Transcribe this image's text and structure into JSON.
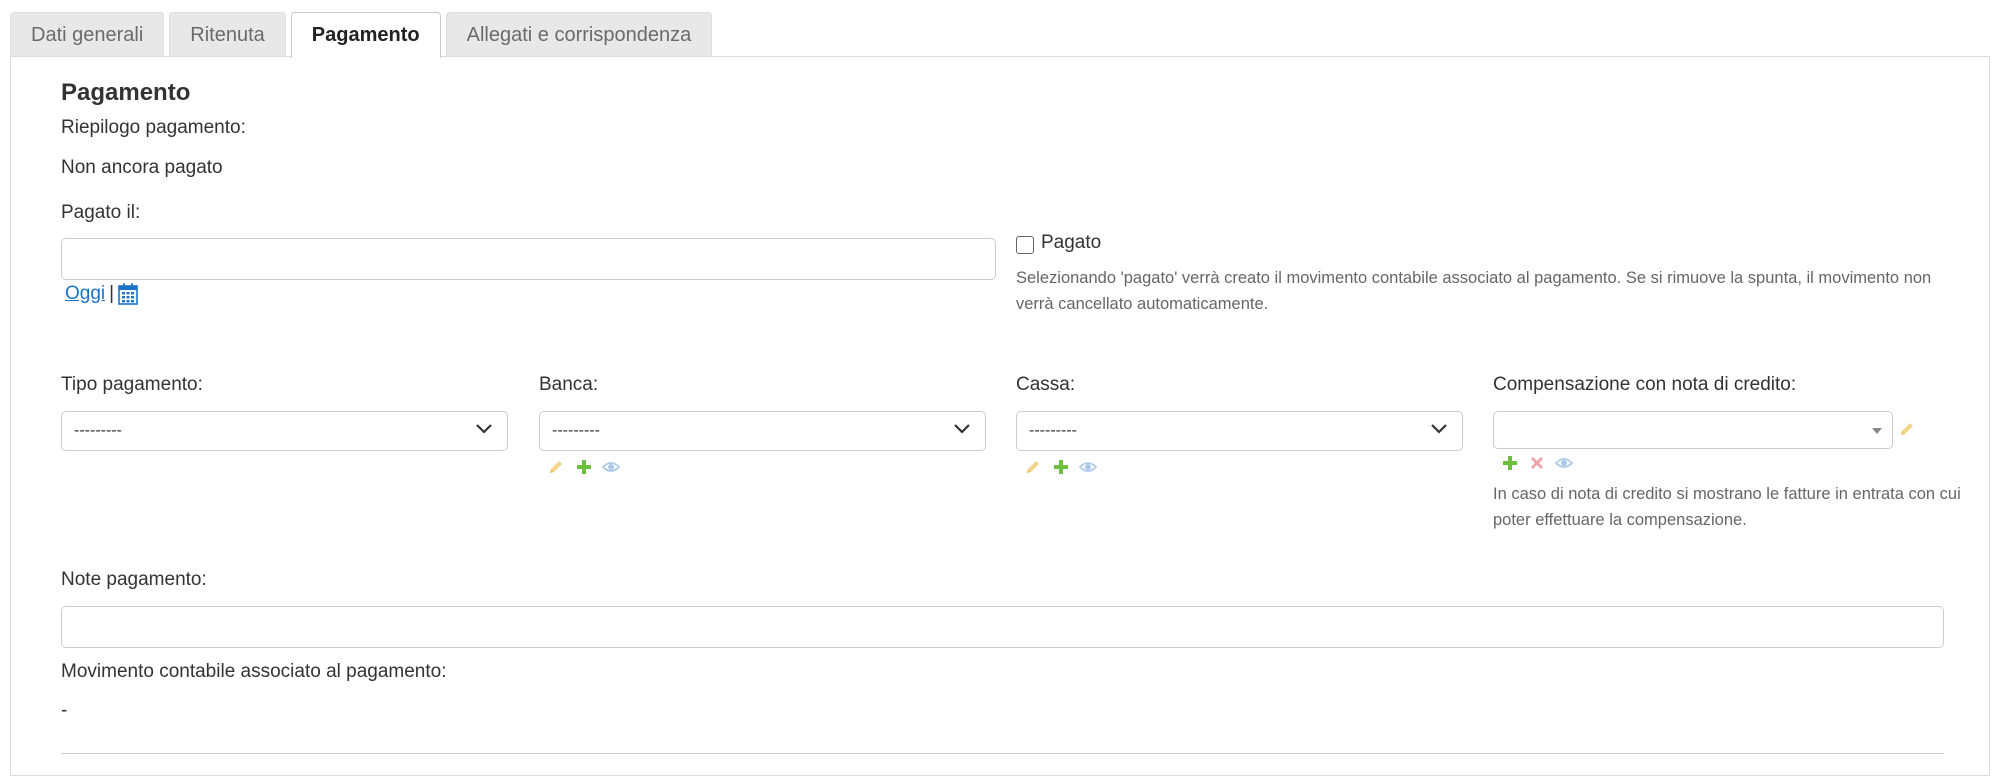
{
  "tabs": [
    {
      "label": "Dati generali"
    },
    {
      "label": "Ritenuta"
    },
    {
      "label": "Pagamento"
    },
    {
      "label": "Allegati e corrispondenza"
    }
  ],
  "section": {
    "title": "Pagamento",
    "summary_label": "Riepilogo pagamento:",
    "summary_value": "Non ancora pagato"
  },
  "paid_on": {
    "label": "Pagato il:",
    "value": "",
    "today_link": "Oggi",
    "separator": "|",
    "calendar_icon": "calendar-icon"
  },
  "paid_checkbox": {
    "label": "Pagato",
    "checked": false,
    "help": "Selezionando 'pagato' verrà creato il movimento contabile associato al pagamento. Se si rimuove la spunta, il movimento non verrà cancellato automaticamente."
  },
  "payment_type": {
    "label": "Tipo pagamento:",
    "selected": "---------"
  },
  "bank": {
    "label": "Banca:",
    "selected": "---------",
    "icons": [
      "pencil-icon",
      "plus-icon",
      "eye-icon"
    ]
  },
  "cash": {
    "label": "Cassa:",
    "selected": "---------",
    "icons": [
      "pencil-icon",
      "plus-icon",
      "eye-icon"
    ]
  },
  "credit_note": {
    "label": "Compensazione con nota di credito:",
    "selected": "",
    "icons": [
      "pencil-icon",
      "plus-icon",
      "delete-icon",
      "eye-icon"
    ],
    "help": "In caso di nota di credito si mostrano le fatture in entrata con cui poter effettuare la compensazione."
  },
  "payment_notes": {
    "label": "Note pagamento:",
    "value": ""
  },
  "accounting_movement": {
    "label": "Movimento contabile associato al pagamento:",
    "value": "-"
  },
  "colors": {
    "link": "#1a73c9",
    "pencil": "#f2d58a",
    "plus": "#6cbf3f",
    "eye": "#a9c7e8",
    "delete": "#f0a6a6"
  }
}
